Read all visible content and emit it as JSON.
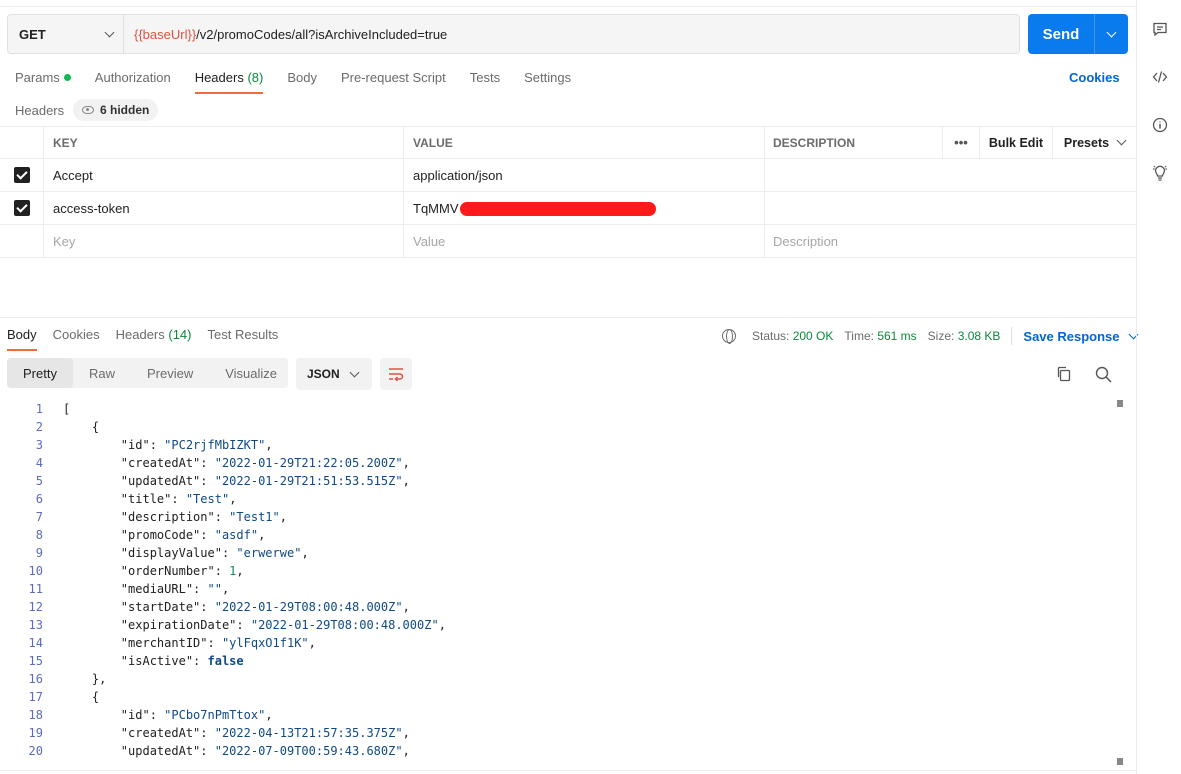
{
  "request": {
    "method": "GET",
    "url_var": "{{baseUrl}}",
    "url_path": "/v2/promoCodes/all?isArchiveIncluded=true",
    "send_label": "Send"
  },
  "req_tabs": {
    "params": "Params",
    "authorization": "Authorization",
    "headers": "Headers",
    "headers_count": "(8)",
    "body": "Body",
    "prerequest": "Pre-request Script",
    "tests": "Tests",
    "settings": "Settings",
    "cookies": "Cookies"
  },
  "headers_section": {
    "label": "Headers",
    "hidden_chip": "6 hidden",
    "columns": {
      "key": "KEY",
      "value": "VALUE",
      "description": "DESCRIPTION"
    },
    "more": "•••",
    "bulk_edit": "Bulk Edit",
    "presets": "Presets",
    "rows": [
      {
        "key": "Accept",
        "value": "application/json",
        "description": ""
      },
      {
        "key": "access-token",
        "value": "TqMMV",
        "description": ""
      }
    ],
    "placeholders": {
      "key": "Key",
      "value": "Value",
      "description": "Description"
    }
  },
  "response": {
    "tabs": {
      "body": "Body",
      "cookies": "Cookies",
      "headers": "Headers",
      "headers_count": "(14)",
      "test_results": "Test Results"
    },
    "status_label": "Status:",
    "status_value": "200 OK",
    "time_label": "Time:",
    "time_value": "561 ms",
    "size_label": "Size:",
    "size_value": "3.08 KB",
    "save_response": "Save Response",
    "views": [
      "Pretty",
      "Raw",
      "Preview",
      "Visualize"
    ],
    "format": "JSON"
  },
  "code_lines": [
    [
      {
        "t": "p",
        "v": "["
      }
    ],
    [
      {
        "t": "p",
        "v": "    {"
      }
    ],
    [
      {
        "t": "k",
        "v": "        \"id\""
      },
      {
        "t": "p",
        "v": ": "
      },
      {
        "t": "s",
        "v": "\"PC2rjfMbIZKT\""
      },
      {
        "t": "p",
        "v": ","
      }
    ],
    [
      {
        "t": "k",
        "v": "        \"createdAt\""
      },
      {
        "t": "p",
        "v": ": "
      },
      {
        "t": "s",
        "v": "\"2022-01-29T21:22:05.200Z\""
      },
      {
        "t": "p",
        "v": ","
      }
    ],
    [
      {
        "t": "k",
        "v": "        \"updatedAt\""
      },
      {
        "t": "p",
        "v": ": "
      },
      {
        "t": "s",
        "v": "\"2022-01-29T21:51:53.515Z\""
      },
      {
        "t": "p",
        "v": ","
      }
    ],
    [
      {
        "t": "k",
        "v": "        \"title\""
      },
      {
        "t": "p",
        "v": ": "
      },
      {
        "t": "s",
        "v": "\"Test\""
      },
      {
        "t": "p",
        "v": ","
      }
    ],
    [
      {
        "t": "k",
        "v": "        \"description\""
      },
      {
        "t": "p",
        "v": ": "
      },
      {
        "t": "s",
        "v": "\"Test1\""
      },
      {
        "t": "p",
        "v": ","
      }
    ],
    [
      {
        "t": "k",
        "v": "        \"promoCode\""
      },
      {
        "t": "p",
        "v": ": "
      },
      {
        "t": "s",
        "v": "\"asdf\""
      },
      {
        "t": "p",
        "v": ","
      }
    ],
    [
      {
        "t": "k",
        "v": "        \"displayValue\""
      },
      {
        "t": "p",
        "v": ": "
      },
      {
        "t": "s",
        "v": "\"erwerwe\""
      },
      {
        "t": "p",
        "v": ","
      }
    ],
    [
      {
        "t": "k",
        "v": "        \"orderNumber\""
      },
      {
        "t": "p",
        "v": ": "
      },
      {
        "t": "n",
        "v": "1"
      },
      {
        "t": "p",
        "v": ","
      }
    ],
    [
      {
        "t": "k",
        "v": "        \"mediaURL\""
      },
      {
        "t": "p",
        "v": ": "
      },
      {
        "t": "s",
        "v": "\"\""
      },
      {
        "t": "p",
        "v": ","
      }
    ],
    [
      {
        "t": "k",
        "v": "        \"startDate\""
      },
      {
        "t": "p",
        "v": ": "
      },
      {
        "t": "s",
        "v": "\"2022-01-29T08:00:48.000Z\""
      },
      {
        "t": "p",
        "v": ","
      }
    ],
    [
      {
        "t": "k",
        "v": "        \"expirationDate\""
      },
      {
        "t": "p",
        "v": ": "
      },
      {
        "t": "s",
        "v": "\"2022-01-29T08:00:48.000Z\""
      },
      {
        "t": "p",
        "v": ","
      }
    ],
    [
      {
        "t": "k",
        "v": "        \"merchantID\""
      },
      {
        "t": "p",
        "v": ": "
      },
      {
        "t": "s",
        "v": "\"ylFqxO1f1K\""
      },
      {
        "t": "p",
        "v": ","
      }
    ],
    [
      {
        "t": "k",
        "v": "        \"isActive\""
      },
      {
        "t": "p",
        "v": ": "
      },
      {
        "t": "b",
        "v": "false"
      }
    ],
    [
      {
        "t": "p",
        "v": "    },"
      }
    ],
    [
      {
        "t": "p",
        "v": "    {"
      }
    ],
    [
      {
        "t": "k",
        "v": "        \"id\""
      },
      {
        "t": "p",
        "v": ": "
      },
      {
        "t": "s",
        "v": "\"PCbo7nPmTtox\""
      },
      {
        "t": "p",
        "v": ","
      }
    ],
    [
      {
        "t": "k",
        "v": "        \"createdAt\""
      },
      {
        "t": "p",
        "v": ": "
      },
      {
        "t": "s",
        "v": "\"2022-04-13T21:57:35.375Z\""
      },
      {
        "t": "p",
        "v": ","
      }
    ],
    [
      {
        "t": "k",
        "v": "        \"updatedAt\""
      },
      {
        "t": "p",
        "v": ": "
      },
      {
        "t": "s",
        "v": "\"2022-07-09T00:59:43.680Z\""
      },
      {
        "t": "p",
        "v": ","
      }
    ]
  ],
  "icons": {
    "sidebar": [
      "comment-icon",
      "code-icon",
      "info-icon",
      "lightbulb-icon"
    ]
  },
  "colors": {
    "accent_blue": "#097bed",
    "tab_underline": "#f26b3a",
    "status_ok": "#0a8a3a",
    "url_variable": "#e05243"
  }
}
